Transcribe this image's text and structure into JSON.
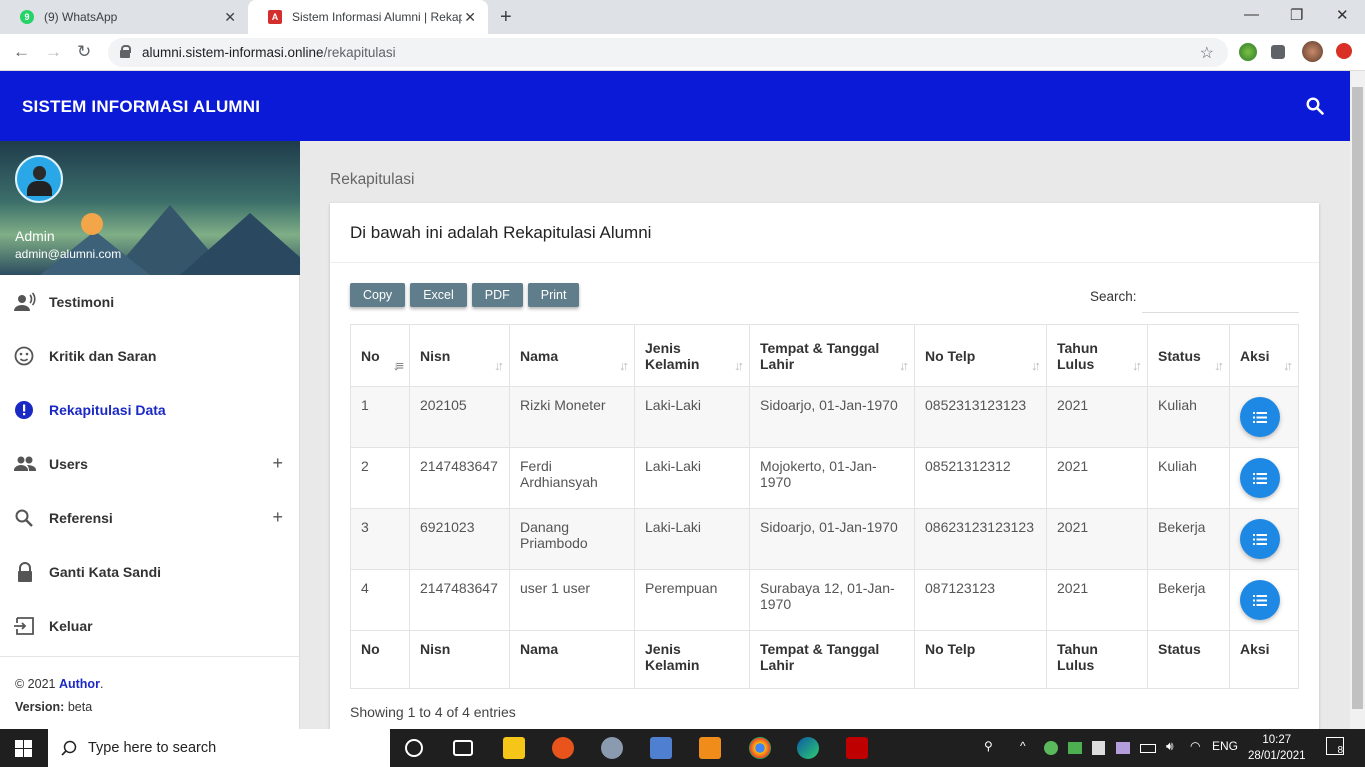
{
  "browser": {
    "tabs": [
      {
        "title": "(9) WhatsApp",
        "active": false
      },
      {
        "title": "Sistem Informasi Alumni | Rekapitulasi",
        "active": true
      }
    ],
    "url_host": "alumni.sistem-informasi.online",
    "url_path": "/rekapitulasi"
  },
  "header": {
    "brand": "SISTEM INFORMASI ALUMNI"
  },
  "sidebar": {
    "user_name": "Admin",
    "user_email": "admin@alumni.com",
    "items": [
      {
        "label": "Testimoni",
        "icon": "record-voice-icon"
      },
      {
        "label": "Kritik dan Saran",
        "icon": "smiley-icon"
      },
      {
        "label": "Rekapitulasi Data",
        "icon": "alert-circle-icon",
        "active": true
      },
      {
        "label": "Users",
        "icon": "people-icon",
        "expandable": true
      },
      {
        "label": "Referensi",
        "icon": "search-icon",
        "expandable": true
      },
      {
        "label": "Ganti Kata Sandi",
        "icon": "lock-icon"
      },
      {
        "label": "Keluar",
        "icon": "logout-icon"
      }
    ],
    "footer": {
      "copyright": "© 2021 ",
      "author": "Author",
      "version_label": "Version:",
      "version": "beta"
    }
  },
  "main": {
    "breadcrumb": "Rekapitulasi",
    "card_title": "Di bawah ini adalah Rekapitulasi Alumni",
    "export_buttons": [
      "Copy",
      "Excel",
      "PDF",
      "Print"
    ],
    "search_label": "Search:",
    "search_value": "",
    "columns": [
      "No",
      "Nisn",
      "Nama",
      "Jenis Kelamin",
      "Tempat & Tanggal Lahir",
      "No Telp",
      "Tahun Lulus",
      "Status",
      "Aksi"
    ],
    "rows": [
      {
        "no": "1",
        "nisn": "202105",
        "nama": "Rizki Moneter",
        "jk": "Laki-Laki",
        "ttl": "Sidoarjo, 01-Jan-1970",
        "telp": "0852313123123",
        "tahun": "2021",
        "status": "Kuliah"
      },
      {
        "no": "2",
        "nisn": "2147483647",
        "nama": "Ferdi Ardhiansyah",
        "jk": "Laki-Laki",
        "ttl": "Mojokerto, 01-Jan-1970",
        "telp": "08521312312",
        "tahun": "2021",
        "status": "Kuliah"
      },
      {
        "no": "3",
        "nisn": "6921023",
        "nama": "Danang Priambodo",
        "jk": "Laki-Laki",
        "ttl": "Sidoarjo, 01-Jan-1970",
        "telp": "08623123123123",
        "tahun": "2021",
        "status": "Bekerja"
      },
      {
        "no": "4",
        "nisn": "2147483647",
        "nama": "user 1 user",
        "jk": "Perempuan",
        "ttl": "Surabaya 12, 01-Jan-1970",
        "telp": "087123123",
        "tahun": "2021",
        "status": "Bekerja"
      }
    ],
    "showing": "Showing 1 to 4 of 4 entries"
  },
  "taskbar": {
    "search_placeholder": "Type here to search",
    "lang": "ENG",
    "time": "10:27",
    "date": "28/01/2021",
    "notifications": "8"
  },
  "colors": {
    "header_bg": "#0b1ad6",
    "accent": "#1a29c4",
    "action_button": "#1e88e5",
    "export_button": "#607d8b"
  }
}
